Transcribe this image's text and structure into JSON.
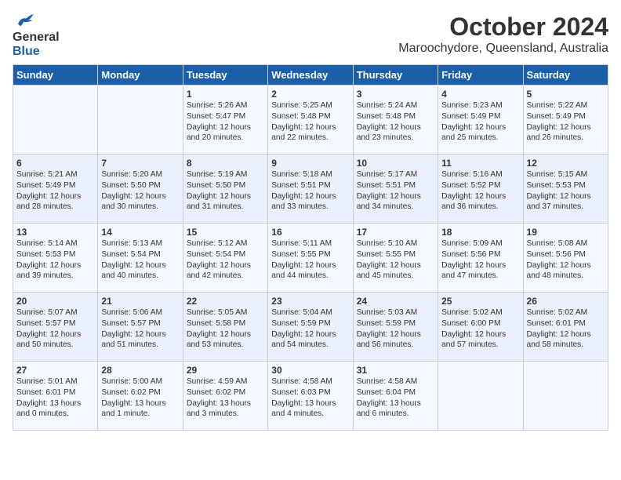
{
  "header": {
    "logo_line1": "General",
    "logo_line2": "Blue",
    "title": "October 2024",
    "subtitle": "Maroochydore, Queensland, Australia"
  },
  "days_of_week": [
    "Sunday",
    "Monday",
    "Tuesday",
    "Wednesday",
    "Thursday",
    "Friday",
    "Saturday"
  ],
  "weeks": [
    [
      {
        "day": "",
        "info": ""
      },
      {
        "day": "",
        "info": ""
      },
      {
        "day": "1",
        "info": "Sunrise: 5:26 AM\nSunset: 5:47 PM\nDaylight: 12 hours\nand 20 minutes."
      },
      {
        "day": "2",
        "info": "Sunrise: 5:25 AM\nSunset: 5:48 PM\nDaylight: 12 hours\nand 22 minutes."
      },
      {
        "day": "3",
        "info": "Sunrise: 5:24 AM\nSunset: 5:48 PM\nDaylight: 12 hours\nand 23 minutes."
      },
      {
        "day": "4",
        "info": "Sunrise: 5:23 AM\nSunset: 5:49 PM\nDaylight: 12 hours\nand 25 minutes."
      },
      {
        "day": "5",
        "info": "Sunrise: 5:22 AM\nSunset: 5:49 PM\nDaylight: 12 hours\nand 26 minutes."
      }
    ],
    [
      {
        "day": "6",
        "info": "Sunrise: 5:21 AM\nSunset: 5:49 PM\nDaylight: 12 hours\nand 28 minutes."
      },
      {
        "day": "7",
        "info": "Sunrise: 5:20 AM\nSunset: 5:50 PM\nDaylight: 12 hours\nand 30 minutes."
      },
      {
        "day": "8",
        "info": "Sunrise: 5:19 AM\nSunset: 5:50 PM\nDaylight: 12 hours\nand 31 minutes."
      },
      {
        "day": "9",
        "info": "Sunrise: 5:18 AM\nSunset: 5:51 PM\nDaylight: 12 hours\nand 33 minutes."
      },
      {
        "day": "10",
        "info": "Sunrise: 5:17 AM\nSunset: 5:51 PM\nDaylight: 12 hours\nand 34 minutes."
      },
      {
        "day": "11",
        "info": "Sunrise: 5:16 AM\nSunset: 5:52 PM\nDaylight: 12 hours\nand 36 minutes."
      },
      {
        "day": "12",
        "info": "Sunrise: 5:15 AM\nSunset: 5:53 PM\nDaylight: 12 hours\nand 37 minutes."
      }
    ],
    [
      {
        "day": "13",
        "info": "Sunrise: 5:14 AM\nSunset: 5:53 PM\nDaylight: 12 hours\nand 39 minutes."
      },
      {
        "day": "14",
        "info": "Sunrise: 5:13 AM\nSunset: 5:54 PM\nDaylight: 12 hours\nand 40 minutes."
      },
      {
        "day": "15",
        "info": "Sunrise: 5:12 AM\nSunset: 5:54 PM\nDaylight: 12 hours\nand 42 minutes."
      },
      {
        "day": "16",
        "info": "Sunrise: 5:11 AM\nSunset: 5:55 PM\nDaylight: 12 hours\nand 44 minutes."
      },
      {
        "day": "17",
        "info": "Sunrise: 5:10 AM\nSunset: 5:55 PM\nDaylight: 12 hours\nand 45 minutes."
      },
      {
        "day": "18",
        "info": "Sunrise: 5:09 AM\nSunset: 5:56 PM\nDaylight: 12 hours\nand 47 minutes."
      },
      {
        "day": "19",
        "info": "Sunrise: 5:08 AM\nSunset: 5:56 PM\nDaylight: 12 hours\nand 48 minutes."
      }
    ],
    [
      {
        "day": "20",
        "info": "Sunrise: 5:07 AM\nSunset: 5:57 PM\nDaylight: 12 hours\nand 50 minutes."
      },
      {
        "day": "21",
        "info": "Sunrise: 5:06 AM\nSunset: 5:57 PM\nDaylight: 12 hours\nand 51 minutes."
      },
      {
        "day": "22",
        "info": "Sunrise: 5:05 AM\nSunset: 5:58 PM\nDaylight: 12 hours\nand 53 minutes."
      },
      {
        "day": "23",
        "info": "Sunrise: 5:04 AM\nSunset: 5:59 PM\nDaylight: 12 hours\nand 54 minutes."
      },
      {
        "day": "24",
        "info": "Sunrise: 5:03 AM\nSunset: 5:59 PM\nDaylight: 12 hours\nand 56 minutes."
      },
      {
        "day": "25",
        "info": "Sunrise: 5:02 AM\nSunset: 6:00 PM\nDaylight: 12 hours\nand 57 minutes."
      },
      {
        "day": "26",
        "info": "Sunrise: 5:02 AM\nSunset: 6:01 PM\nDaylight: 12 hours\nand 58 minutes."
      }
    ],
    [
      {
        "day": "27",
        "info": "Sunrise: 5:01 AM\nSunset: 6:01 PM\nDaylight: 13 hours\nand 0 minutes."
      },
      {
        "day": "28",
        "info": "Sunrise: 5:00 AM\nSunset: 6:02 PM\nDaylight: 13 hours\nand 1 minute."
      },
      {
        "day": "29",
        "info": "Sunrise: 4:59 AM\nSunset: 6:02 PM\nDaylight: 13 hours\nand 3 minutes."
      },
      {
        "day": "30",
        "info": "Sunrise: 4:58 AM\nSunset: 6:03 PM\nDaylight: 13 hours\nand 4 minutes."
      },
      {
        "day": "31",
        "info": "Sunrise: 4:58 AM\nSunset: 6:04 PM\nDaylight: 13 hours\nand 6 minutes."
      },
      {
        "day": "",
        "info": ""
      },
      {
        "day": "",
        "info": ""
      }
    ]
  ]
}
